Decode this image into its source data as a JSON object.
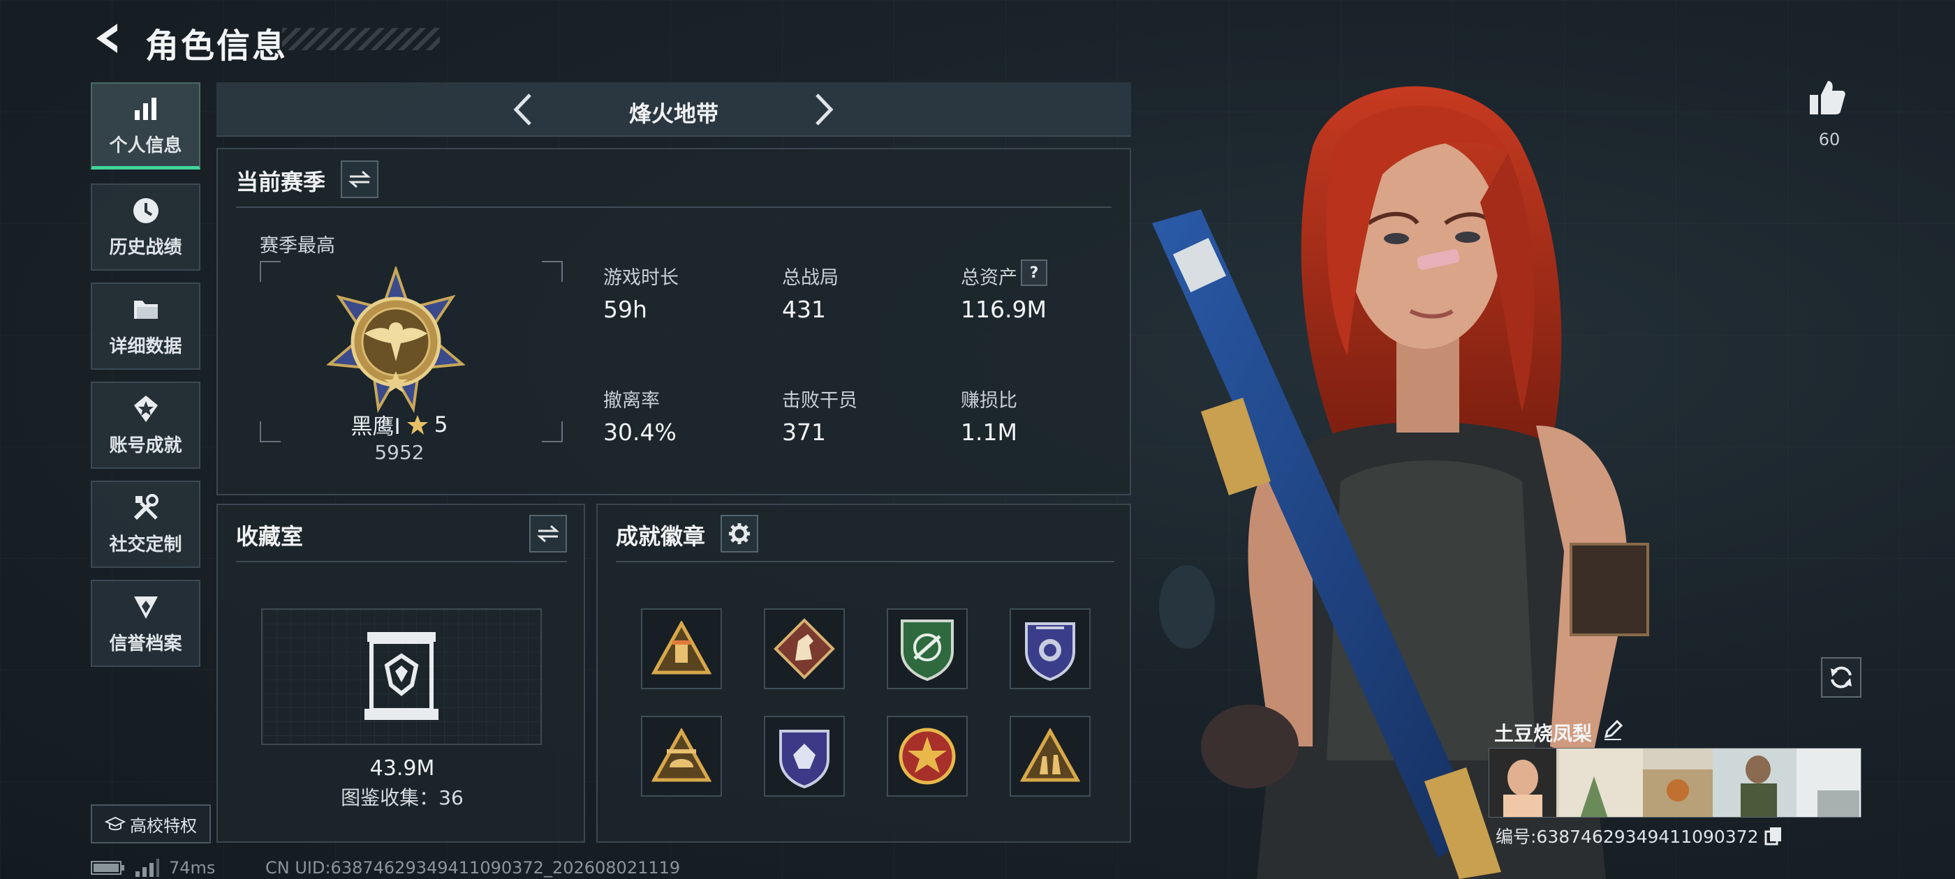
{
  "header": {
    "title": "角色信息"
  },
  "sidebar": {
    "items": [
      {
        "label": "个人信息",
        "icon": "bar-chart-icon",
        "active": true
      },
      {
        "label": "历史战绩",
        "icon": "clock-icon",
        "active": false
      },
      {
        "label": "详细数据",
        "icon": "folder-icon",
        "active": false
      },
      {
        "label": "账号成就",
        "icon": "achievement-icon",
        "active": false
      },
      {
        "label": "社交定制",
        "icon": "tools-icon",
        "active": false
      },
      {
        "label": "信誉档案",
        "icon": "reputation-icon",
        "active": false
      }
    ],
    "campus_label": "高校特权"
  },
  "mode": {
    "title": "烽火地带"
  },
  "season": {
    "title": "当前赛季",
    "best_label": "赛季最高",
    "rank_name": "黑鹰I",
    "rank_stars": "5",
    "rank_score": "5952",
    "stats": [
      {
        "label": "游戏时长",
        "value": "59h"
      },
      {
        "label": "总战局",
        "value": "431"
      },
      {
        "label": "总资产",
        "value": "116.9M",
        "help": "?"
      },
      {
        "label": "撤离率",
        "value": "30.4%"
      },
      {
        "label": "击败干员",
        "value": "371"
      },
      {
        "label": "赚损比",
        "value": "1.1M"
      }
    ]
  },
  "collection": {
    "title": "收藏室",
    "value": "43.9M",
    "count_text": "图鉴收集：36"
  },
  "badges": {
    "title": "成就徽章",
    "items": [
      "badge-triangle-gold",
      "badge-diamond-horse",
      "badge-green-shield",
      "badge-blue-shield",
      "badge-triangle-helmet",
      "badge-blue-crest",
      "badge-red-star",
      "badge-triangle-soldiers"
    ]
  },
  "profile": {
    "likes": "60",
    "player_name": "土豆烧凤梨",
    "player_id": "编号:638746293494110903​72"
  },
  "status": {
    "ping": "74ms",
    "uid": "CN UID:638746293494110903​72_202608021119"
  },
  "colors": {
    "accent": "#3fd49a",
    "panel": "#1c262c",
    "hair": "#b8321c"
  }
}
